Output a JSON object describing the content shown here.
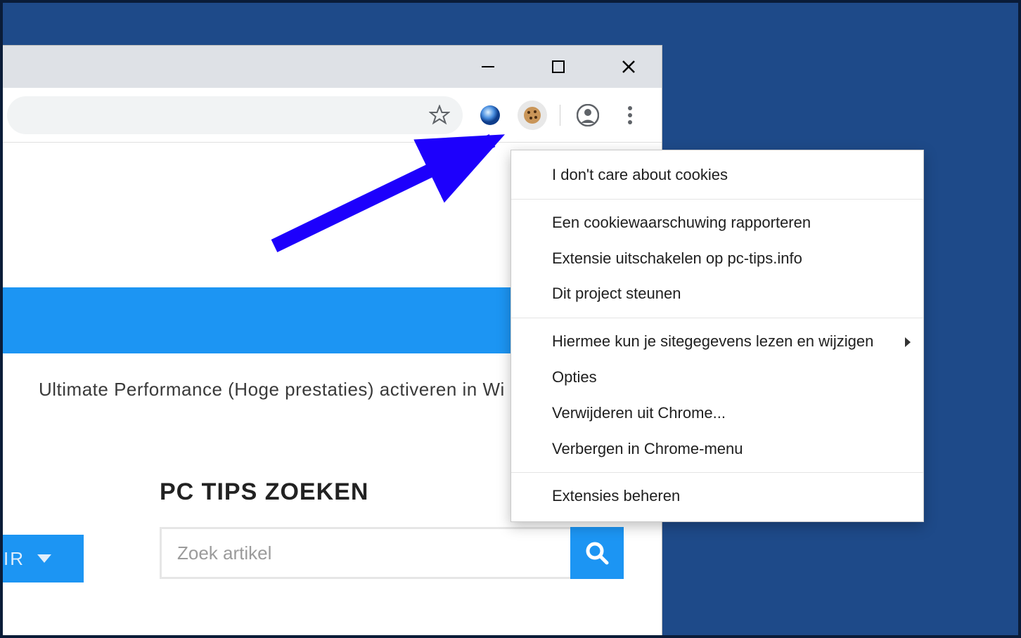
{
  "window_controls": {
    "minimize": "minimize",
    "maximize": "maximize",
    "close": "close"
  },
  "page": {
    "article_title_partial": "Ultimate Performance (Hoge prestaties) activeren in Wi",
    "search_section_title": "PC TIPS ZOEKEN",
    "search_placeholder": "Zoek artikel",
    "dropdown_partial_label": "IR"
  },
  "context_menu": {
    "title": "I don't care about cookies",
    "items_group1": [
      "Een cookiewaarschuwing rapporteren",
      "Extensie uitschakelen op pc-tips.info",
      "Dit project steunen"
    ],
    "items_group2_submenu": "Hiermee kun je sitegegevens lezen en wijzigen",
    "items_group2": [
      "Opties",
      "Verwijderen uit Chrome...",
      "Verbergen in Chrome-menu"
    ],
    "items_group3": [
      "Extensies beheren"
    ]
  },
  "colors": {
    "desktop_bg": "#1e4a89",
    "banner_blue": "#1c95f3",
    "titlebar": "#dee1e6",
    "arrow": "#1d00fc"
  }
}
